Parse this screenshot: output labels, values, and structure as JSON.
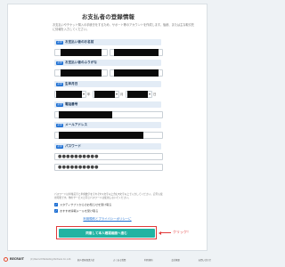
{
  "title": "お支払者の登録情報",
  "intro": "お支払いやチケット購入の手続きをするため、サポート等のアカウントを作成します。後続、または主な取引先に情報を入力してください。",
  "fields": {
    "name": {
      "badge": "必須",
      "label": "お支払い者のお名前"
    },
    "kana": {
      "badge": "必須",
      "label": "お支払い者のふりがな"
    },
    "birthday": {
      "badge": "必須",
      "label": "生年月日",
      "year_suffix": "年",
      "month_suffix": "月",
      "day_suffix": "日"
    },
    "phone": {
      "badge": "必須",
      "label": "電話番号"
    },
    "email": {
      "badge": "必須",
      "label": "メールアドレス"
    },
    "password": {
      "badge": "必須",
      "label": "パスワード",
      "value_masked": "●●●●●●●●●●",
      "confirm_masked": "●●●●●●●●●●"
    }
  },
  "password_note": "パスワードは半角英字と半角数字をそれぞれ1文字以上含む8文字以上で入力してください。記号も使用可能です。他のサービスと同じパスワードは使用しないでください。",
  "checkboxes": [
    {
      "label": "スタディサプリからのお知らせを受け取る",
      "checked": true
    },
    {
      "label": "おすすめ情報メールを受け取る",
      "checked": true
    }
  ],
  "terms_link": "利用規約とプライバシーポリシーに",
  "submit_label": "同意して本人確認画面へ進む",
  "callout": "クリック！",
  "footer": {
    "logo": "RECRUIT",
    "copyright": "(C) Recruit Marketing Partners Co.,Ltd.",
    "links": [
      "個人情報保護方針",
      "よくある質問",
      "利用規約",
      "会社概要",
      "お問い合わせ"
    ]
  },
  "colors": {
    "accent": "#1b6ed3",
    "submit": "#22b3a2",
    "callout": "#e23a3a"
  }
}
